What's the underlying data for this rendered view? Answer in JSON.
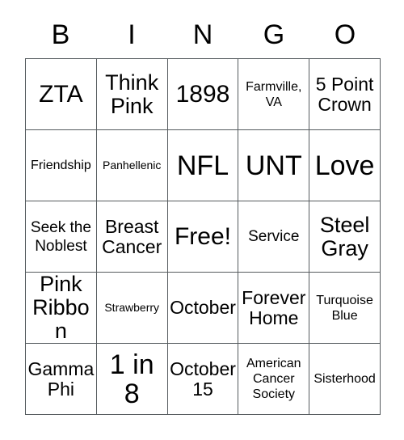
{
  "page": {
    "type": "bingo-card",
    "background_color": "#ffffff",
    "text_color": "#000000",
    "border_color": "#555b5e",
    "columns": 5,
    "rows": 5
  },
  "header": {
    "letters": [
      "B",
      "I",
      "N",
      "G",
      "O"
    ]
  },
  "grid": {
    "rows": [
      [
        {
          "label": "ZTA",
          "size": "xl"
        },
        {
          "label": "Think Pink",
          "size": "lg"
        },
        {
          "label": "1898",
          "size": "xl"
        },
        {
          "label": "Farmville, VA",
          "size": "xs"
        },
        {
          "label": "5 Point Crown",
          "size": "md"
        }
      ],
      [
        {
          "label": "Friendship",
          "size": "xs"
        },
        {
          "label": "Panhellenic",
          "size": "xxs"
        },
        {
          "label": "NFL",
          "size": "xxl"
        },
        {
          "label": "UNT",
          "size": "xxl"
        },
        {
          "label": "Love",
          "size": "xxl"
        }
      ],
      [
        {
          "label": "Seek the Noblest",
          "size": "sm"
        },
        {
          "label": "Breast Cancer",
          "size": "md"
        },
        {
          "label": "Free!",
          "size": "xl"
        },
        {
          "label": "Service",
          "size": "sm"
        },
        {
          "label": "Steel Gray",
          "size": "lg"
        }
      ],
      [
        {
          "label": "Pink Ribbon",
          "size": "lg"
        },
        {
          "label": "Strawberry",
          "size": "xxs"
        },
        {
          "label": "October",
          "size": "md"
        },
        {
          "label": "Forever Home",
          "size": "md"
        },
        {
          "label": "Turquoise Blue",
          "size": "xs"
        }
      ],
      [
        {
          "label": "Gamma Phi",
          "size": "md"
        },
        {
          "label": "1 in 8",
          "size": "xxl"
        },
        {
          "label": "October 15",
          "size": "md"
        },
        {
          "label": "American Cancer Society",
          "size": "xs"
        },
        {
          "label": "Sisterhood",
          "size": "xs"
        }
      ]
    ]
  }
}
